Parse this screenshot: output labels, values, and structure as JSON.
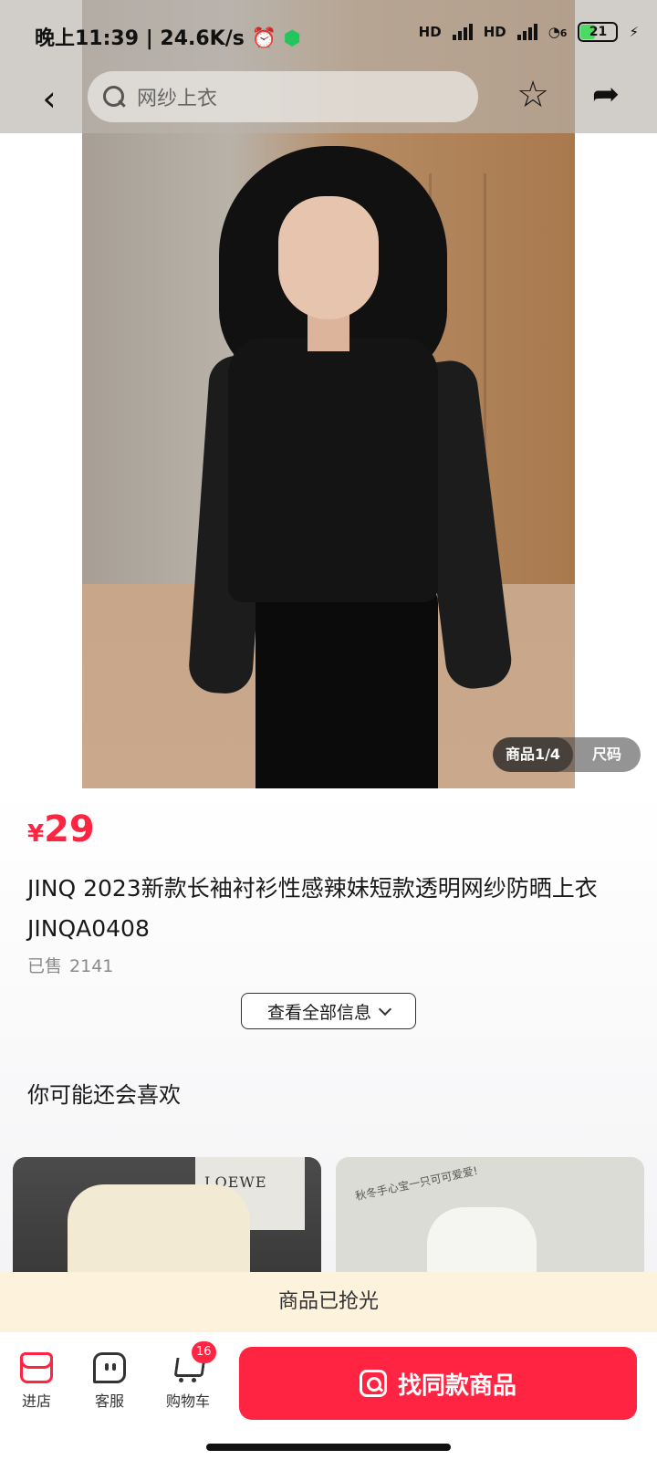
{
  "status_bar": {
    "time": "晚上11:39",
    "network_speed": "24.6K/s",
    "signal_label_1": "HD",
    "signal_label_2": "HD",
    "wifi_label": "6",
    "battery": "21"
  },
  "nav": {
    "search_placeholder": "网纱上衣"
  },
  "gallery": {
    "page_indicator": "商品1/4",
    "size_tab": "尺码"
  },
  "product": {
    "currency": "¥",
    "price": "29",
    "title": "JINQ 2023新款长袖衬衫性感辣妹短款透明网纱防晒上衣 JINQA0408",
    "sold_label": "已售",
    "sold_count": "2141",
    "more_info": "查看全部信息"
  },
  "recommend": {
    "title": "你可能还会喜欢",
    "card_left_brand": "LOEWE",
    "card_right_note": "秋冬手心宝一只可可爱爱!"
  },
  "soldout": {
    "text": "商品已抢光"
  },
  "bottom_bar": {
    "shop_label": "进店",
    "service_label": "客服",
    "cart_label": "购物车",
    "cart_count": "16",
    "find_similar": "找同款商品"
  },
  "colors": {
    "accent": "#ff2442",
    "soldout_bg": "#fdf2dc"
  }
}
